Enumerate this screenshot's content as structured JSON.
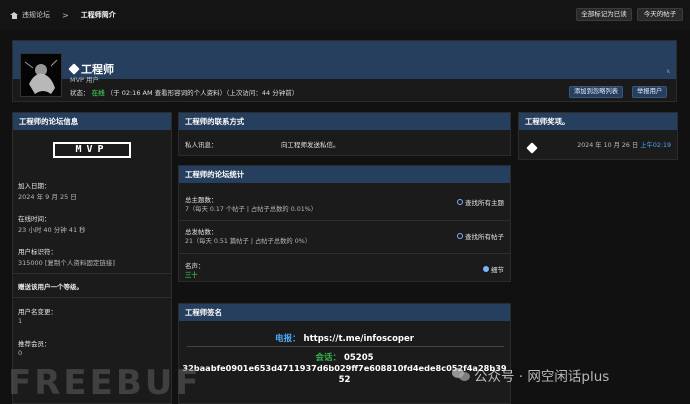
{
  "breadcrumb": {
    "home": "违规论坛",
    "current": "工程师简介"
  },
  "top_actions": {
    "mark_read": "全部标记为已读",
    "today_posts": "今天的帖子"
  },
  "profile": {
    "name": "工程师",
    "role": "MVP 用户",
    "status_label": "状态：",
    "status_online": "在线",
    "status_detail": "（于 02:16 AM 查看形容词的个人资料）（上次访问：44 分钟前）",
    "btn_ignore": "添加到忽略列表",
    "btn_report": "举报用户",
    "badge_k": "k"
  },
  "forum_info": {
    "title": "工程师的论坛信息",
    "badge": "MVP",
    "join_label": "加入日期：",
    "join_value": "2024 年 9 月 25 日",
    "online_label": "在线时间：",
    "online_value": "23 小时 40 分钟 41 秒",
    "uid_label": "用户标识符：",
    "uid_value": "315000 [复制个人资料固定链接]",
    "gift_text": "赠送该用户一个等级。",
    "rename_label": "用户名变更：",
    "rename_value": "1",
    "referral_label": "推荐会员：",
    "referral_value": "0"
  },
  "contact": {
    "title": "工程师的联系方式",
    "pm_label": "私人讯息：",
    "pm_action": "向工程师发送私信。"
  },
  "stats": {
    "title": "工程师的论坛统计",
    "threads_label": "总主题数：",
    "threads_value": "7（每天 0.17 个帖子 | 占帖子总数的 0.01%）",
    "threads_link": "查找所有主题",
    "posts_label": "总发帖数：",
    "posts_value": "21（每天 0.51 篇帖子 | 占帖子总数的 0%）",
    "posts_link": "查找所有帖子",
    "rep_label": "名声：",
    "rep_value": "三十",
    "rep_link": "细节"
  },
  "awards": {
    "title": "工程师奖项。",
    "date_prefix": "2024 年 10 月 26 日",
    "date_time": "上午02:19"
  },
  "signature": {
    "title": "工程师签名",
    "telegram_label": "电报：",
    "telegram_value": "https://t.me/infoscoper",
    "session_label": "会话：",
    "session_value": "05205",
    "session_id": "32baabfe0901e653d4711937d6b029ff7e608810fd4ede8c052f4a28b39",
    "session_tail": "52"
  },
  "watermark": {
    "freebuf": "FREEBUF",
    "wechat": "公众号 · 网空闲话plus"
  }
}
